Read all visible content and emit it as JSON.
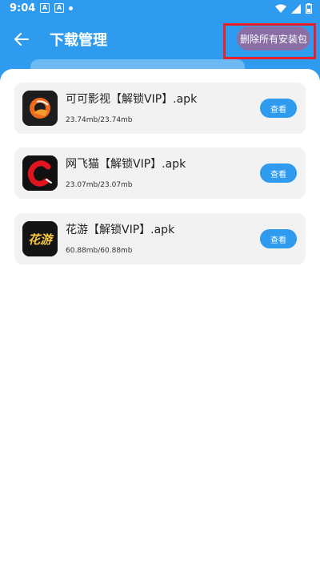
{
  "status_bar": {
    "time": "9:04",
    "icons": [
      "notification-a-icon",
      "notification-a-icon",
      "dot-icon",
      "wifi-icon",
      "signal-icon",
      "battery-icon"
    ]
  },
  "header": {
    "title": "下载管理",
    "delete_all_label": "删除所有安装包",
    "accent_color": "#2e9bef",
    "highlight_color": "#e8202a"
  },
  "downloads": [
    {
      "name": "可可影视【解锁VIP】.apk",
      "size": "23.74mb/23.74mb",
      "action": "查看",
      "icon": "keke-icon"
    },
    {
      "name": "网飞猫【解锁VIP】.apk",
      "size": "23.07mb/23.07mb",
      "action": "查看",
      "icon": "wangfeimao-icon"
    },
    {
      "name": "花游【解锁VIP】.apk",
      "size": "60.88mb/60.88mb",
      "action": "查看",
      "icon": "huayou-icon",
      "icon_text": "花游"
    }
  ]
}
